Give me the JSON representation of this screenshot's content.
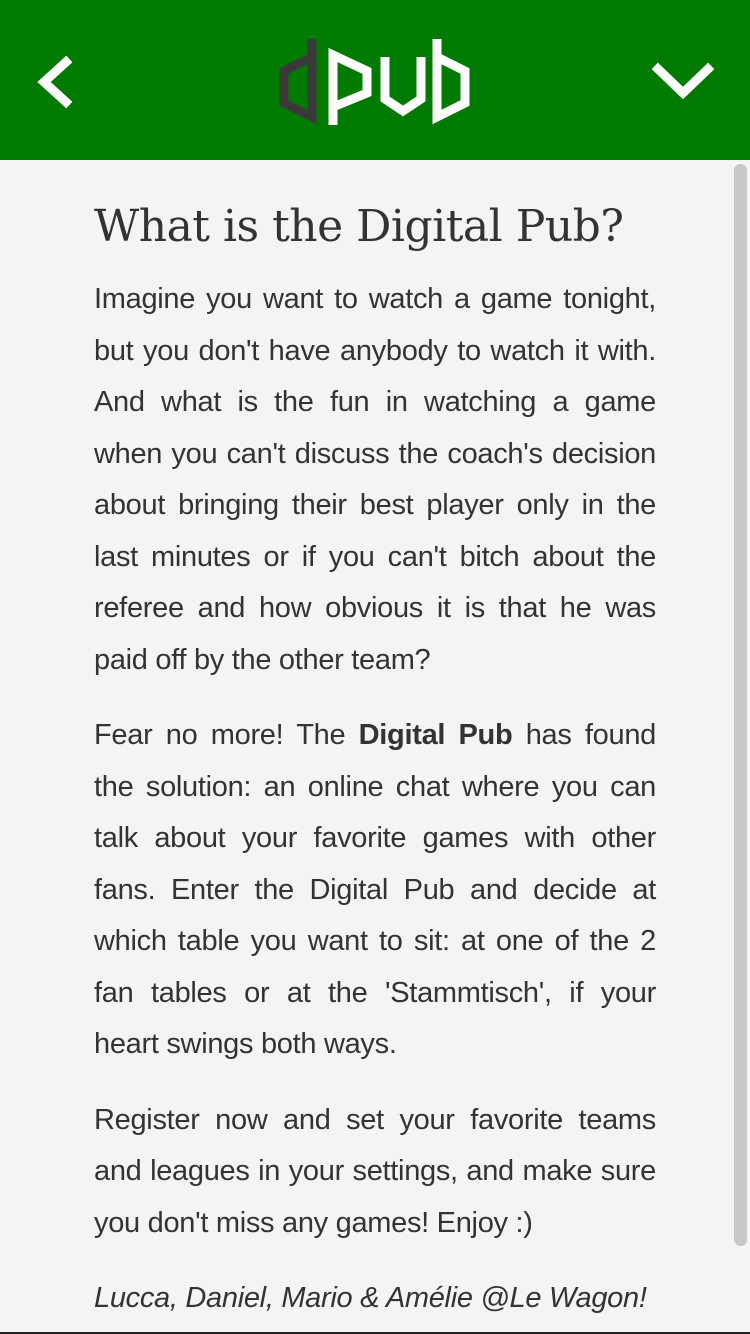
{
  "header": {
    "logo_text": "dPub",
    "back_icon": "chevron-left-icon",
    "menu_icon": "chevron-down-icon",
    "background_color": "#007a00"
  },
  "article": {
    "title": "What is the Digital Pub?",
    "paragraph1": "Imagine you want to watch a game tonight, but you don't have anybody to watch it with. And what is the fun in watching a game when you can't discuss the coach's decision about bringing their best player only in the last minutes or if you can't bitch about the referee and how obvious it is that he was paid off by the other team?",
    "paragraph2_before": "Fear no more! The ",
    "paragraph2_bold": "Digital Pub",
    "paragraph2_after": " has found the solution: an online chat where you can talk about your favorite games with other fans. Enter the Digital Pub and decide at which table you want to sit: at one of the 2 fan tables or at the 'Stammtisch', if your heart swings both ways.",
    "paragraph3": "Register now and set your favorite teams and leagues in your settings, and make sure you don't miss any games! Enjoy :)",
    "signature": "Lucca, Daniel, Mario & Amélie @Le Wagon!"
  }
}
